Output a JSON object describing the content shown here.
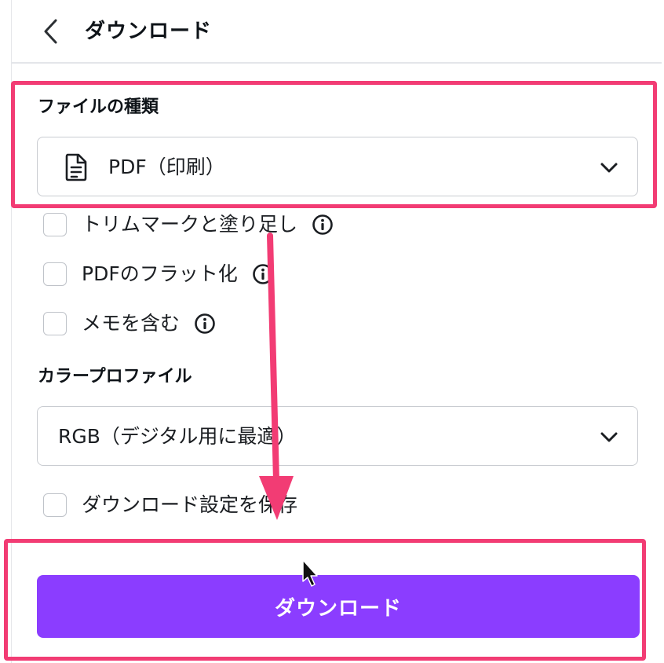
{
  "header": {
    "title": "ダウンロード"
  },
  "file_type": {
    "label": "ファイルの種類",
    "value": "PDF（印刷）"
  },
  "options": [
    {
      "label": "トリムマークと塗り足し",
      "checked": false
    },
    {
      "label": "PDFのフラット化",
      "checked": false
    },
    {
      "label": "メモを含む",
      "checked": false
    }
  ],
  "color_profile": {
    "label": "カラープロファイル",
    "value": "RGB（デジタル用に最適）"
  },
  "save_settings": {
    "label": "ダウンロード設定を保存",
    "checked": false
  },
  "download_button": {
    "label": "ダウンロード"
  },
  "colors": {
    "accent": "#8b3dff",
    "annotation": "#f23c74",
    "border": "#c9ccd1"
  }
}
